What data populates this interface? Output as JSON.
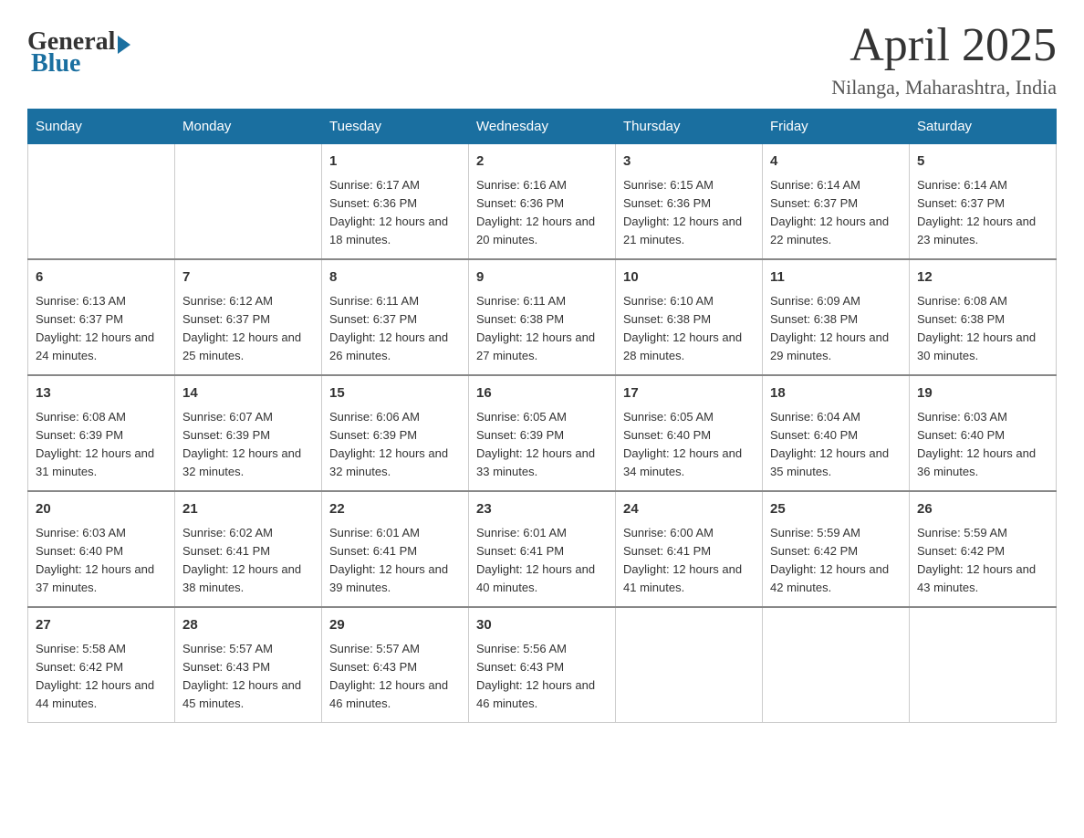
{
  "header": {
    "logo_general": "General",
    "logo_blue": "Blue",
    "month_title": "April 2025",
    "location": "Nilanga, Maharashtra, India"
  },
  "weekdays": [
    "Sunday",
    "Monday",
    "Tuesday",
    "Wednesday",
    "Thursday",
    "Friday",
    "Saturday"
  ],
  "weeks": [
    [
      {
        "day": "",
        "sunrise": "",
        "sunset": "",
        "daylight": ""
      },
      {
        "day": "",
        "sunrise": "",
        "sunset": "",
        "daylight": ""
      },
      {
        "day": "1",
        "sunrise": "Sunrise: 6:17 AM",
        "sunset": "Sunset: 6:36 PM",
        "daylight": "Daylight: 12 hours and 18 minutes."
      },
      {
        "day": "2",
        "sunrise": "Sunrise: 6:16 AM",
        "sunset": "Sunset: 6:36 PM",
        "daylight": "Daylight: 12 hours and 20 minutes."
      },
      {
        "day": "3",
        "sunrise": "Sunrise: 6:15 AM",
        "sunset": "Sunset: 6:36 PM",
        "daylight": "Daylight: 12 hours and 21 minutes."
      },
      {
        "day": "4",
        "sunrise": "Sunrise: 6:14 AM",
        "sunset": "Sunset: 6:37 PM",
        "daylight": "Daylight: 12 hours and 22 minutes."
      },
      {
        "day": "5",
        "sunrise": "Sunrise: 6:14 AM",
        "sunset": "Sunset: 6:37 PM",
        "daylight": "Daylight: 12 hours and 23 minutes."
      }
    ],
    [
      {
        "day": "6",
        "sunrise": "Sunrise: 6:13 AM",
        "sunset": "Sunset: 6:37 PM",
        "daylight": "Daylight: 12 hours and 24 minutes."
      },
      {
        "day": "7",
        "sunrise": "Sunrise: 6:12 AM",
        "sunset": "Sunset: 6:37 PM",
        "daylight": "Daylight: 12 hours and 25 minutes."
      },
      {
        "day": "8",
        "sunrise": "Sunrise: 6:11 AM",
        "sunset": "Sunset: 6:37 PM",
        "daylight": "Daylight: 12 hours and 26 minutes."
      },
      {
        "day": "9",
        "sunrise": "Sunrise: 6:11 AM",
        "sunset": "Sunset: 6:38 PM",
        "daylight": "Daylight: 12 hours and 27 minutes."
      },
      {
        "day": "10",
        "sunrise": "Sunrise: 6:10 AM",
        "sunset": "Sunset: 6:38 PM",
        "daylight": "Daylight: 12 hours and 28 minutes."
      },
      {
        "day": "11",
        "sunrise": "Sunrise: 6:09 AM",
        "sunset": "Sunset: 6:38 PM",
        "daylight": "Daylight: 12 hours and 29 minutes."
      },
      {
        "day": "12",
        "sunrise": "Sunrise: 6:08 AM",
        "sunset": "Sunset: 6:38 PM",
        "daylight": "Daylight: 12 hours and 30 minutes."
      }
    ],
    [
      {
        "day": "13",
        "sunrise": "Sunrise: 6:08 AM",
        "sunset": "Sunset: 6:39 PM",
        "daylight": "Daylight: 12 hours and 31 minutes."
      },
      {
        "day": "14",
        "sunrise": "Sunrise: 6:07 AM",
        "sunset": "Sunset: 6:39 PM",
        "daylight": "Daylight: 12 hours and 32 minutes."
      },
      {
        "day": "15",
        "sunrise": "Sunrise: 6:06 AM",
        "sunset": "Sunset: 6:39 PM",
        "daylight": "Daylight: 12 hours and 32 minutes."
      },
      {
        "day": "16",
        "sunrise": "Sunrise: 6:05 AM",
        "sunset": "Sunset: 6:39 PM",
        "daylight": "Daylight: 12 hours and 33 minutes."
      },
      {
        "day": "17",
        "sunrise": "Sunrise: 6:05 AM",
        "sunset": "Sunset: 6:40 PM",
        "daylight": "Daylight: 12 hours and 34 minutes."
      },
      {
        "day": "18",
        "sunrise": "Sunrise: 6:04 AM",
        "sunset": "Sunset: 6:40 PM",
        "daylight": "Daylight: 12 hours and 35 minutes."
      },
      {
        "day": "19",
        "sunrise": "Sunrise: 6:03 AM",
        "sunset": "Sunset: 6:40 PM",
        "daylight": "Daylight: 12 hours and 36 minutes."
      }
    ],
    [
      {
        "day": "20",
        "sunrise": "Sunrise: 6:03 AM",
        "sunset": "Sunset: 6:40 PM",
        "daylight": "Daylight: 12 hours and 37 minutes."
      },
      {
        "day": "21",
        "sunrise": "Sunrise: 6:02 AM",
        "sunset": "Sunset: 6:41 PM",
        "daylight": "Daylight: 12 hours and 38 minutes."
      },
      {
        "day": "22",
        "sunrise": "Sunrise: 6:01 AM",
        "sunset": "Sunset: 6:41 PM",
        "daylight": "Daylight: 12 hours and 39 minutes."
      },
      {
        "day": "23",
        "sunrise": "Sunrise: 6:01 AM",
        "sunset": "Sunset: 6:41 PM",
        "daylight": "Daylight: 12 hours and 40 minutes."
      },
      {
        "day": "24",
        "sunrise": "Sunrise: 6:00 AM",
        "sunset": "Sunset: 6:41 PM",
        "daylight": "Daylight: 12 hours and 41 minutes."
      },
      {
        "day": "25",
        "sunrise": "Sunrise: 5:59 AM",
        "sunset": "Sunset: 6:42 PM",
        "daylight": "Daylight: 12 hours and 42 minutes."
      },
      {
        "day": "26",
        "sunrise": "Sunrise: 5:59 AM",
        "sunset": "Sunset: 6:42 PM",
        "daylight": "Daylight: 12 hours and 43 minutes."
      }
    ],
    [
      {
        "day": "27",
        "sunrise": "Sunrise: 5:58 AM",
        "sunset": "Sunset: 6:42 PM",
        "daylight": "Daylight: 12 hours and 44 minutes."
      },
      {
        "day": "28",
        "sunrise": "Sunrise: 5:57 AM",
        "sunset": "Sunset: 6:43 PM",
        "daylight": "Daylight: 12 hours and 45 minutes."
      },
      {
        "day": "29",
        "sunrise": "Sunrise: 5:57 AM",
        "sunset": "Sunset: 6:43 PM",
        "daylight": "Daylight: 12 hours and 46 minutes."
      },
      {
        "day": "30",
        "sunrise": "Sunrise: 5:56 AM",
        "sunset": "Sunset: 6:43 PM",
        "daylight": "Daylight: 12 hours and 46 minutes."
      },
      {
        "day": "",
        "sunrise": "",
        "sunset": "",
        "daylight": ""
      },
      {
        "day": "",
        "sunrise": "",
        "sunset": "",
        "daylight": ""
      },
      {
        "day": "",
        "sunrise": "",
        "sunset": "",
        "daylight": ""
      }
    ]
  ]
}
